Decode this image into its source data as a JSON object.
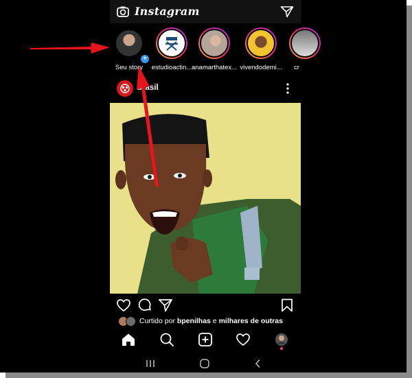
{
  "app": {
    "title": "Instagram"
  },
  "stories": [
    {
      "label": "Seu story",
      "avatar": "own-profile-photo"
    },
    {
      "label": "estudioactin...",
      "avatar": "director-chair-logo"
    },
    {
      "label": "anamarthatex...",
      "avatar": "profile-photo"
    },
    {
      "label": "vivendodemi...",
      "avatar": "profile-photo"
    },
    {
      "label": "cr",
      "avatar": "profile-photo"
    }
  ],
  "post": {
    "username": "brasil",
    "liked_prefix": "Curtido por ",
    "liked_user": "bpenilhas",
    "liked_middle": " e ",
    "liked_suffix": "milhares de outras"
  },
  "colors": {
    "background": "#000000",
    "topbar": "#121212",
    "story_ring": "#e1306c",
    "add_badge": "#3897f0",
    "annotation_arrow": "#e8141c"
  },
  "icons": {
    "topbar": [
      "camera-icon",
      "direct-message-icon"
    ],
    "post_actions": [
      "heart-icon",
      "comment-icon",
      "share-icon",
      "bookmark-icon"
    ],
    "bottom_nav": [
      "home-icon",
      "search-icon",
      "new-post-icon",
      "activity-heart-icon",
      "profile-icon"
    ],
    "system_nav": [
      "recents-icon",
      "home-circle-icon",
      "back-icon"
    ]
  }
}
